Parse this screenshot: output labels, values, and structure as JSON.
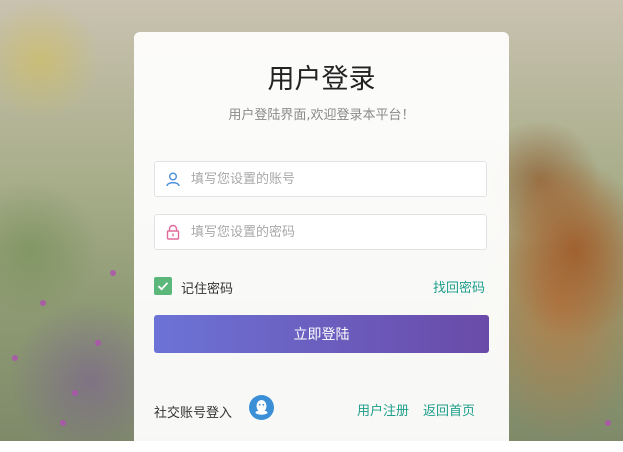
{
  "login": {
    "title": "用户登录",
    "subtitle": "用户登陆界面,欢迎登录本平台！",
    "account_placeholder": "填写您设置的账号",
    "password_placeholder": "填写您设置的密码",
    "remember_label": "记住密码",
    "remember_checked": true,
    "forgot_link": "找回密码",
    "login_button": "立即登陆",
    "social_login_label": "社交账号登入",
    "register_link": "用户注册",
    "home_link": "返回首页"
  },
  "icons": {
    "account": "user-icon",
    "password": "lock-icon",
    "social": "qq-icon"
  },
  "colors": {
    "accent_link": "#1e9e8a",
    "checkbox": "#5cb87a",
    "button_start": "#6c73d6",
    "button_end": "#6a4aa8",
    "user_icon": "#4a90d9",
    "lock_icon": "#e06a9a",
    "qq_icon": "#3a8fd6"
  }
}
